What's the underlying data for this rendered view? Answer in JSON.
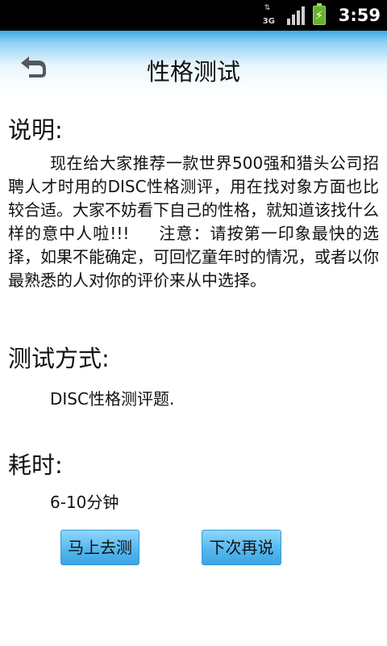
{
  "status_bar": {
    "network_label": "3G",
    "time": "3:59",
    "battery_color": "#6ab02a"
  },
  "header": {
    "title": "性格测试",
    "back_icon": "back-arrow-icon",
    "background_color": "#3aa7e6"
  },
  "instructions": {
    "heading": "说明:",
    "text": "现在给大家推荐一款世界500强和猎头公司招聘人才时用的DISC性格测评，用在找对象方面也比较合适。大家不妨看下自己的性格，就知道该找什么样的意中人啦!!!     注意：请按第一印象最快的选择，如果不能确定，可回忆童年时的情况，或者以你最熟悉的人对你的评价来从中选择。"
  },
  "method": {
    "heading": "测试方式:",
    "value": "DISC性格测评题."
  },
  "duration": {
    "heading": "耗时:",
    "value": "6-10分钟"
  },
  "actions": {
    "start_label": "马上去测",
    "later_label": "下次再说",
    "button_color": "#56b8ee"
  }
}
